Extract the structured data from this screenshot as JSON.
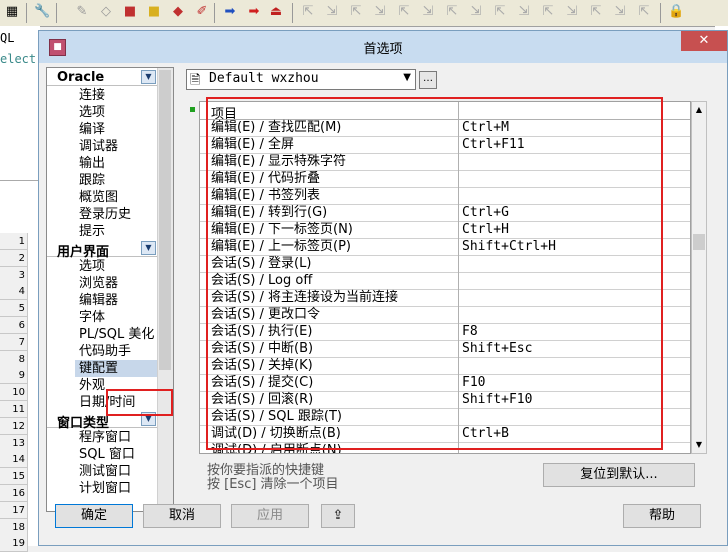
{
  "bg": {
    "sql_label": "QL",
    "select_label": "elect",
    "row_numbers": [
      "1",
      "2",
      "3",
      "4",
      "5",
      "6",
      "7",
      "8",
      "9",
      "10",
      "11",
      "12",
      "13",
      "14",
      "15",
      "16",
      "17",
      "18",
      "19"
    ]
  },
  "dialog": {
    "title": "首选项",
    "close_glyph": "✕",
    "profile": {
      "selected": "Default wxzhou",
      "more_label": "…"
    },
    "categories": [
      {
        "label": "Oracle",
        "items": [
          "连接",
          "选项",
          "编译",
          "调试器",
          "输出",
          "跟踪",
          "概览图",
          "登录历史",
          "提示"
        ]
      },
      {
        "label": "用户界面",
        "items": [
          "选项",
          "浏览器",
          "编辑器",
          "字体",
          "PL/SQL 美化",
          "代码助手",
          "键配置",
          "外观",
          "日期/时间"
        ]
      },
      {
        "label": "窗口类型",
        "items": [
          "程序窗口",
          "SQL 窗口",
          "测试窗口",
          "计划窗口"
        ]
      }
    ],
    "selected_item": "键配置",
    "keys_table": {
      "header_command": "项目",
      "header_key": "",
      "rows": [
        {
          "command": "编辑(E) / 查找匹配(M)",
          "key": "Ctrl+M"
        },
        {
          "command": "编辑(E) / 全屏",
          "key": "Ctrl+F11"
        },
        {
          "command": "编辑(E) / 显示特殊字符",
          "key": ""
        },
        {
          "command": "编辑(E) / 代码折叠",
          "key": ""
        },
        {
          "command": "编辑(E) / 书签列表",
          "key": ""
        },
        {
          "command": "编辑(E) / 转到行(G)",
          "key": "Ctrl+G"
        },
        {
          "command": "编辑(E) / 下一标签页(N)",
          "key": "Ctrl+H"
        },
        {
          "command": "编辑(E) / 上一标签页(P)",
          "key": "Shift+Ctrl+H"
        },
        {
          "command": "会话(S) / 登录(L)",
          "key": ""
        },
        {
          "command": "会话(S) / Log off",
          "key": ""
        },
        {
          "command": "会话(S) / 将主连接设为当前连接",
          "key": ""
        },
        {
          "command": "会话(S) / 更改口令",
          "key": ""
        },
        {
          "command": "会话(S) / 执行(E)",
          "key": "F8"
        },
        {
          "command": "会话(S) / 中断(B)",
          "key": "Shift+Esc"
        },
        {
          "command": "会话(S) / 关掉(K)",
          "key": ""
        },
        {
          "command": "会话(S) / 提交(C)",
          "key": "F10"
        },
        {
          "command": "会话(S) / 回滚(R)",
          "key": "Shift+F10"
        },
        {
          "command": "会话(S) / SQL 跟踪(T)",
          "key": ""
        },
        {
          "command": "调试(D) / 切换断点(B)",
          "key": "Ctrl+B"
        },
        {
          "command": "调试(D) / 启用断点(N)",
          "key": ""
        }
      ]
    },
    "hint1": "按你要指派的快捷键",
    "hint2": "按 [Esc] 清除一个项目",
    "reset_button": "复位到默认...",
    "ok_button": "确定",
    "cancel_button": "取消",
    "apply_button": "应用",
    "help_button": "帮助",
    "accent_color": "#e02020"
  }
}
